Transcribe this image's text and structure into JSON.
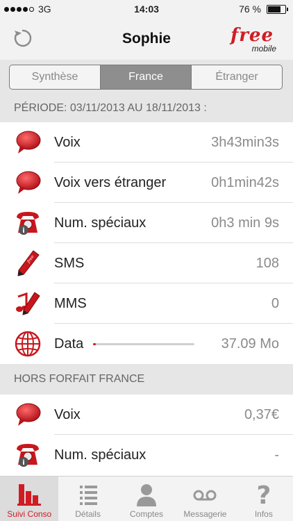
{
  "status": {
    "carrier": "3G",
    "time": "14:03",
    "battery": "76 %",
    "battery_level": 0.76
  },
  "header": {
    "title": "Sophie",
    "logo_free": "free",
    "logo_mobile": "mobile"
  },
  "segments": [
    {
      "label": "Synthèse",
      "active": false
    },
    {
      "label": "France",
      "active": true
    },
    {
      "label": "Étranger",
      "active": false
    }
  ],
  "period": {
    "label": "PÉRIODE: 03/11/2013 AU 18/11/2013 :"
  },
  "usage": [
    {
      "label": "Voix",
      "value": "3h43min3s",
      "icon": "speech-bubble-icon"
    },
    {
      "label": "Voix vers étranger",
      "value": "0h1min42s",
      "icon": "speech-bubble-icon"
    },
    {
      "label": "Num. spéciaux",
      "value": "0h3 min 9s",
      "icon": "telephone-info-icon"
    },
    {
      "label": "SMS",
      "value": "108",
      "icon": "pen-icon"
    },
    {
      "label": "MMS",
      "value": "0",
      "icon": "music-note-pen-icon"
    },
    {
      "label": "Data",
      "value": "37.09 Mo",
      "icon": "globe-icon",
      "progress": 0.03
    }
  ],
  "hors_forfait": {
    "label": "HORS FORFAIT FRANCE",
    "items": [
      {
        "label": "Voix",
        "value": "0,37€",
        "icon": "speech-bubble-icon"
      },
      {
        "label": "Num. spéciaux",
        "value": "-",
        "icon": "telephone-info-icon"
      }
    ]
  },
  "tabs": [
    {
      "label": "Suivi Conso",
      "icon": "bar-chart-icon",
      "active": true
    },
    {
      "label": "Détails",
      "icon": "list-icon",
      "active": false
    },
    {
      "label": "Comptes",
      "icon": "person-icon",
      "active": false
    },
    {
      "label": "Messagerie",
      "icon": "voicemail-icon",
      "active": false
    },
    {
      "label": "Infos",
      "icon": "question-mark-icon",
      "active": false
    }
  ],
  "colors": {
    "accent": "#d01c24",
    "header_bg": "#e6e6e6",
    "value_text": "#8a8a8a"
  }
}
